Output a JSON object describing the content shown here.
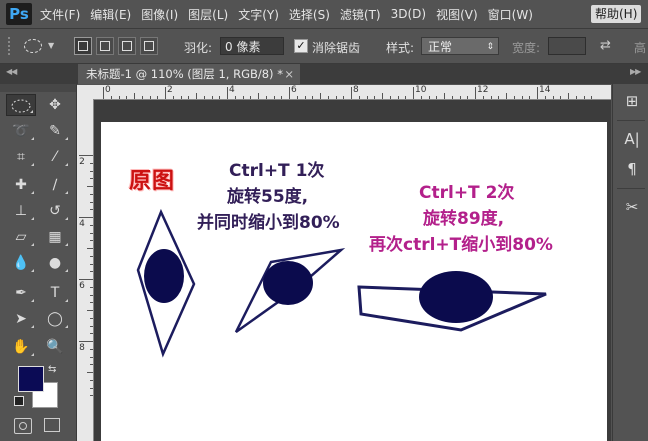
{
  "app": {
    "logo": "Ps"
  },
  "menu": {
    "items": [
      "文件(F)",
      "编辑(E)",
      "图像(I)",
      "图层(L)",
      "文字(Y)",
      "选择(S)",
      "滤镜(T)",
      "3D(D)",
      "视图(V)",
      "窗口(W)"
    ],
    "help": "帮助(H)"
  },
  "options": {
    "feather_label": "羽化:",
    "feather_value": "0 像素",
    "antialias_label": "消除锯齿",
    "antialias_checked": true,
    "style_label": "样式:",
    "style_value": "正常",
    "width_label": "宽度:",
    "height_label": "高"
  },
  "tab": {
    "title": "未标题-1 @ 110% (图层 1, RGB/8) *",
    "close": "×"
  },
  "ruler": {
    "h_labels": [
      "0",
      "2",
      "4",
      "6",
      "8",
      "10",
      "12",
      "14"
    ],
    "v_labels": [
      "2",
      "4",
      "6",
      "8"
    ]
  },
  "canvas": {
    "original_label": "原图",
    "step1": [
      "Ctrl+T  1次",
      "旋转55度,",
      "并同时缩小到80%"
    ],
    "step2": [
      "Ctrl+T  2次",
      "旋转89度,",
      "再次ctrl+T缩小到80%"
    ]
  },
  "colors": {
    "foreground": "#0b0b55",
    "background": "#ffffff",
    "label_red": "#cc1111",
    "label_dark": "#321f58",
    "label_pink": "#b3208b",
    "shape_fill": "#0b0b4d",
    "shape_stroke": "#1c1c5e"
  },
  "tools": [
    "rect-marquee-icon",
    "move-icon",
    "lasso-icon",
    "quick-select-icon",
    "crop-icon",
    "eyedropper-icon",
    "healing-brush-icon",
    "brush-icon",
    "clone-stamp-icon",
    "history-brush-icon",
    "eraser-icon",
    "gradient-icon",
    "blur-icon",
    "dodge-icon",
    "pen-icon",
    "type-icon",
    "path-select-icon",
    "ellipse-icon",
    "hand-icon",
    "zoom-icon"
  ]
}
